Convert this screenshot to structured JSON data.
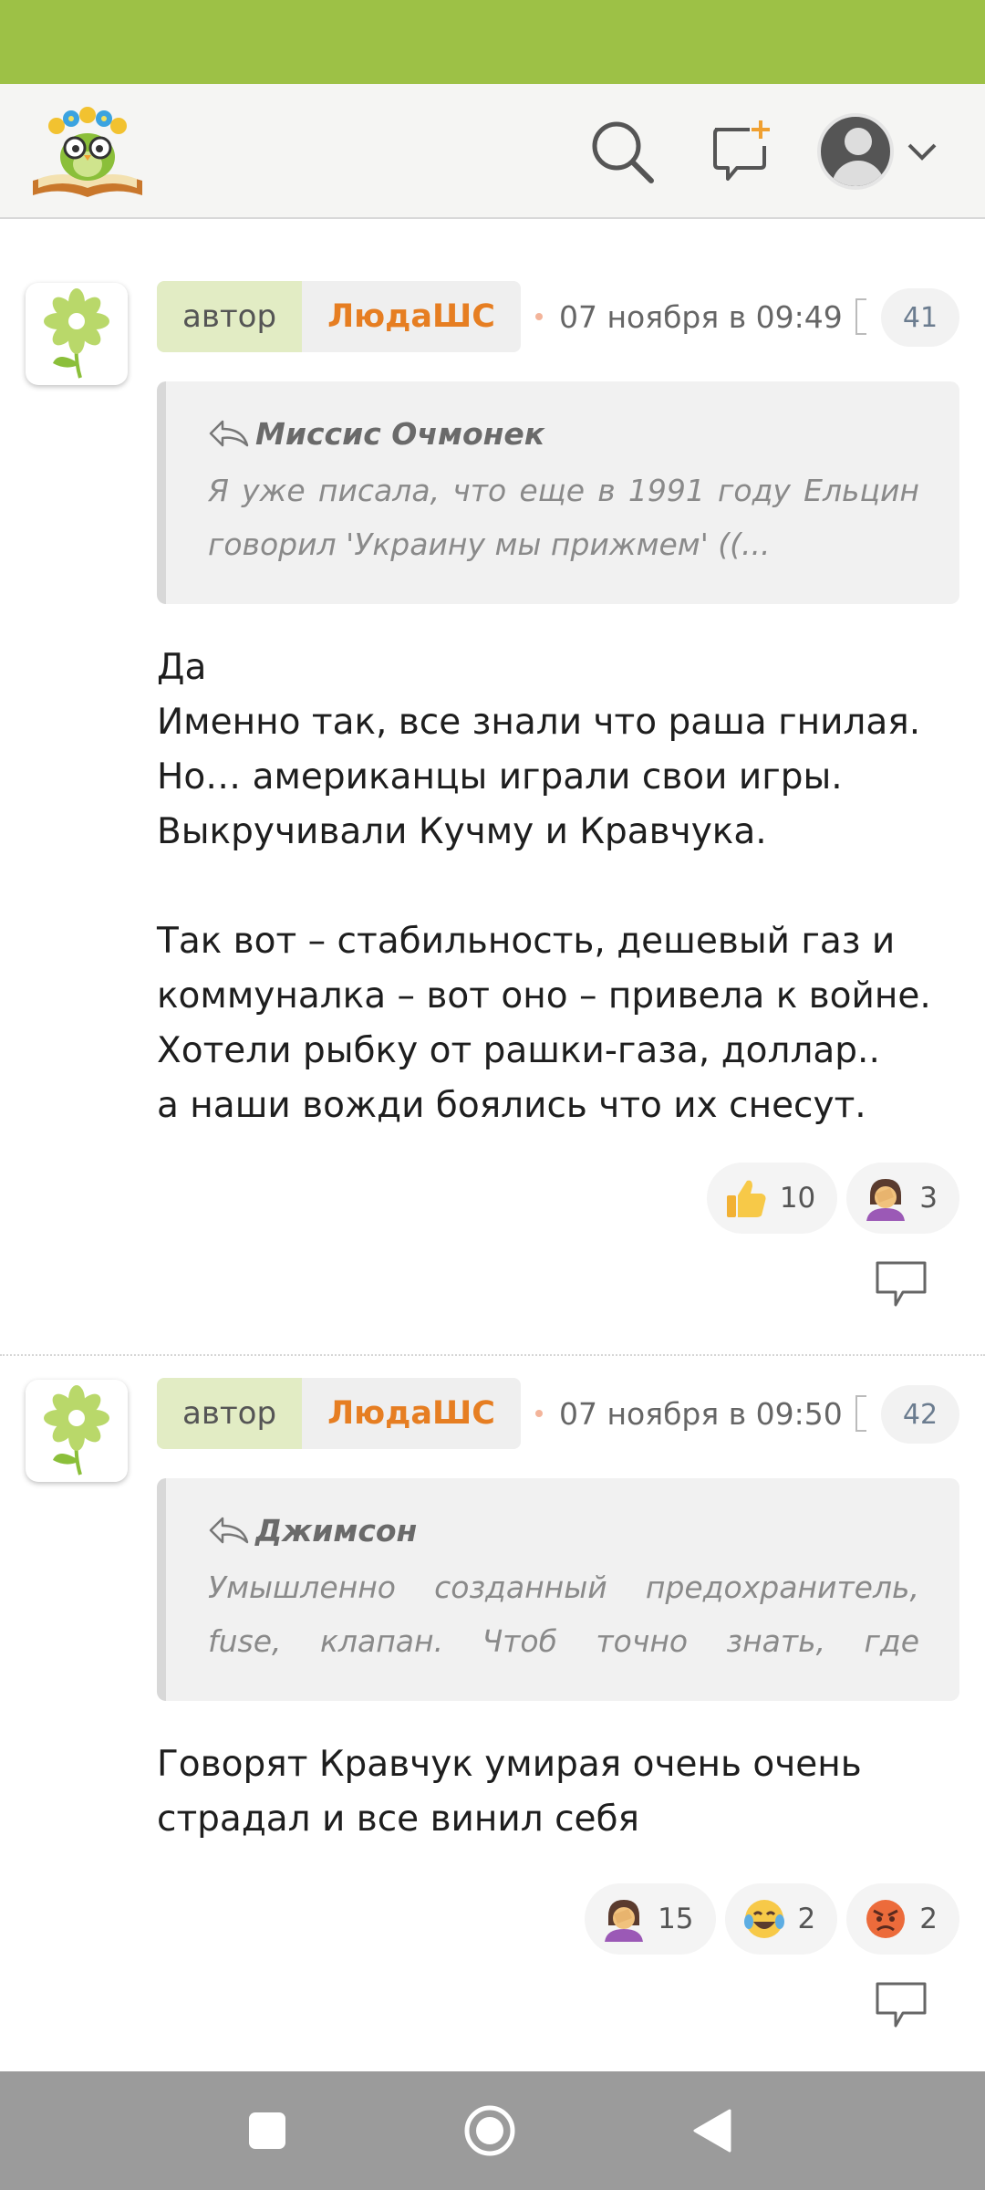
{
  "header": {
    "logo_icon": "owl-on-book-logo",
    "search_icon": "search-icon",
    "new_post_icon": "new-post-icon",
    "profile_icon": "user-avatar-icon"
  },
  "comments": [
    {
      "author_tag": "автор",
      "author_name": "ЛюдаШС",
      "date": "07 ноября в 09:49",
      "number": "41",
      "quote": {
        "author": "Миссис Очмонек",
        "text": "Я уже писала, что еще в 1991 году Ельцин говорил 'Украину мы прижмем' ((..."
      },
      "body": "Да\nИменно так, все знали что раша гнилая.\nНо… американцы играли свои игры.\nВыкручивали Кучму и Кравчука.\n\nТак вот – стабильность, дешевый газ и коммуналка – вот оно – привела к войне.\nХотели рыбку от рашки-газа, доллар..\nа наши вожди боялись что их снесут.",
      "reactions": [
        {
          "icon": "thumbs-up-icon",
          "count": "10"
        },
        {
          "icon": "facepalm-icon",
          "count": "3"
        }
      ]
    },
    {
      "author_tag": "автор",
      "author_name": "ЛюдаШС",
      "date": "07 ноября в 09:50",
      "number": "42",
      "quote": {
        "author": "Джимсон",
        "text": "Умышленно созданный предохранитель, fuse, клапан. Чтоб точно знать, где именно…"
      },
      "body": "Говорят Кравчук умирая очень очень страдал и все винил себя",
      "reactions": [
        {
          "icon": "facepalm-icon",
          "count": "15"
        },
        {
          "icon": "laughing-tears-icon",
          "count": "2"
        },
        {
          "icon": "angry-face-icon",
          "count": "2"
        }
      ]
    }
  ],
  "colors": {
    "status_bar": "#9dc146",
    "author_name": "#e67e22",
    "author_tag_bg": "#e2ecc4"
  },
  "nav": {
    "recents_icon": "square-icon",
    "home_icon": "circle-icon",
    "back_icon": "triangle-back-icon"
  }
}
